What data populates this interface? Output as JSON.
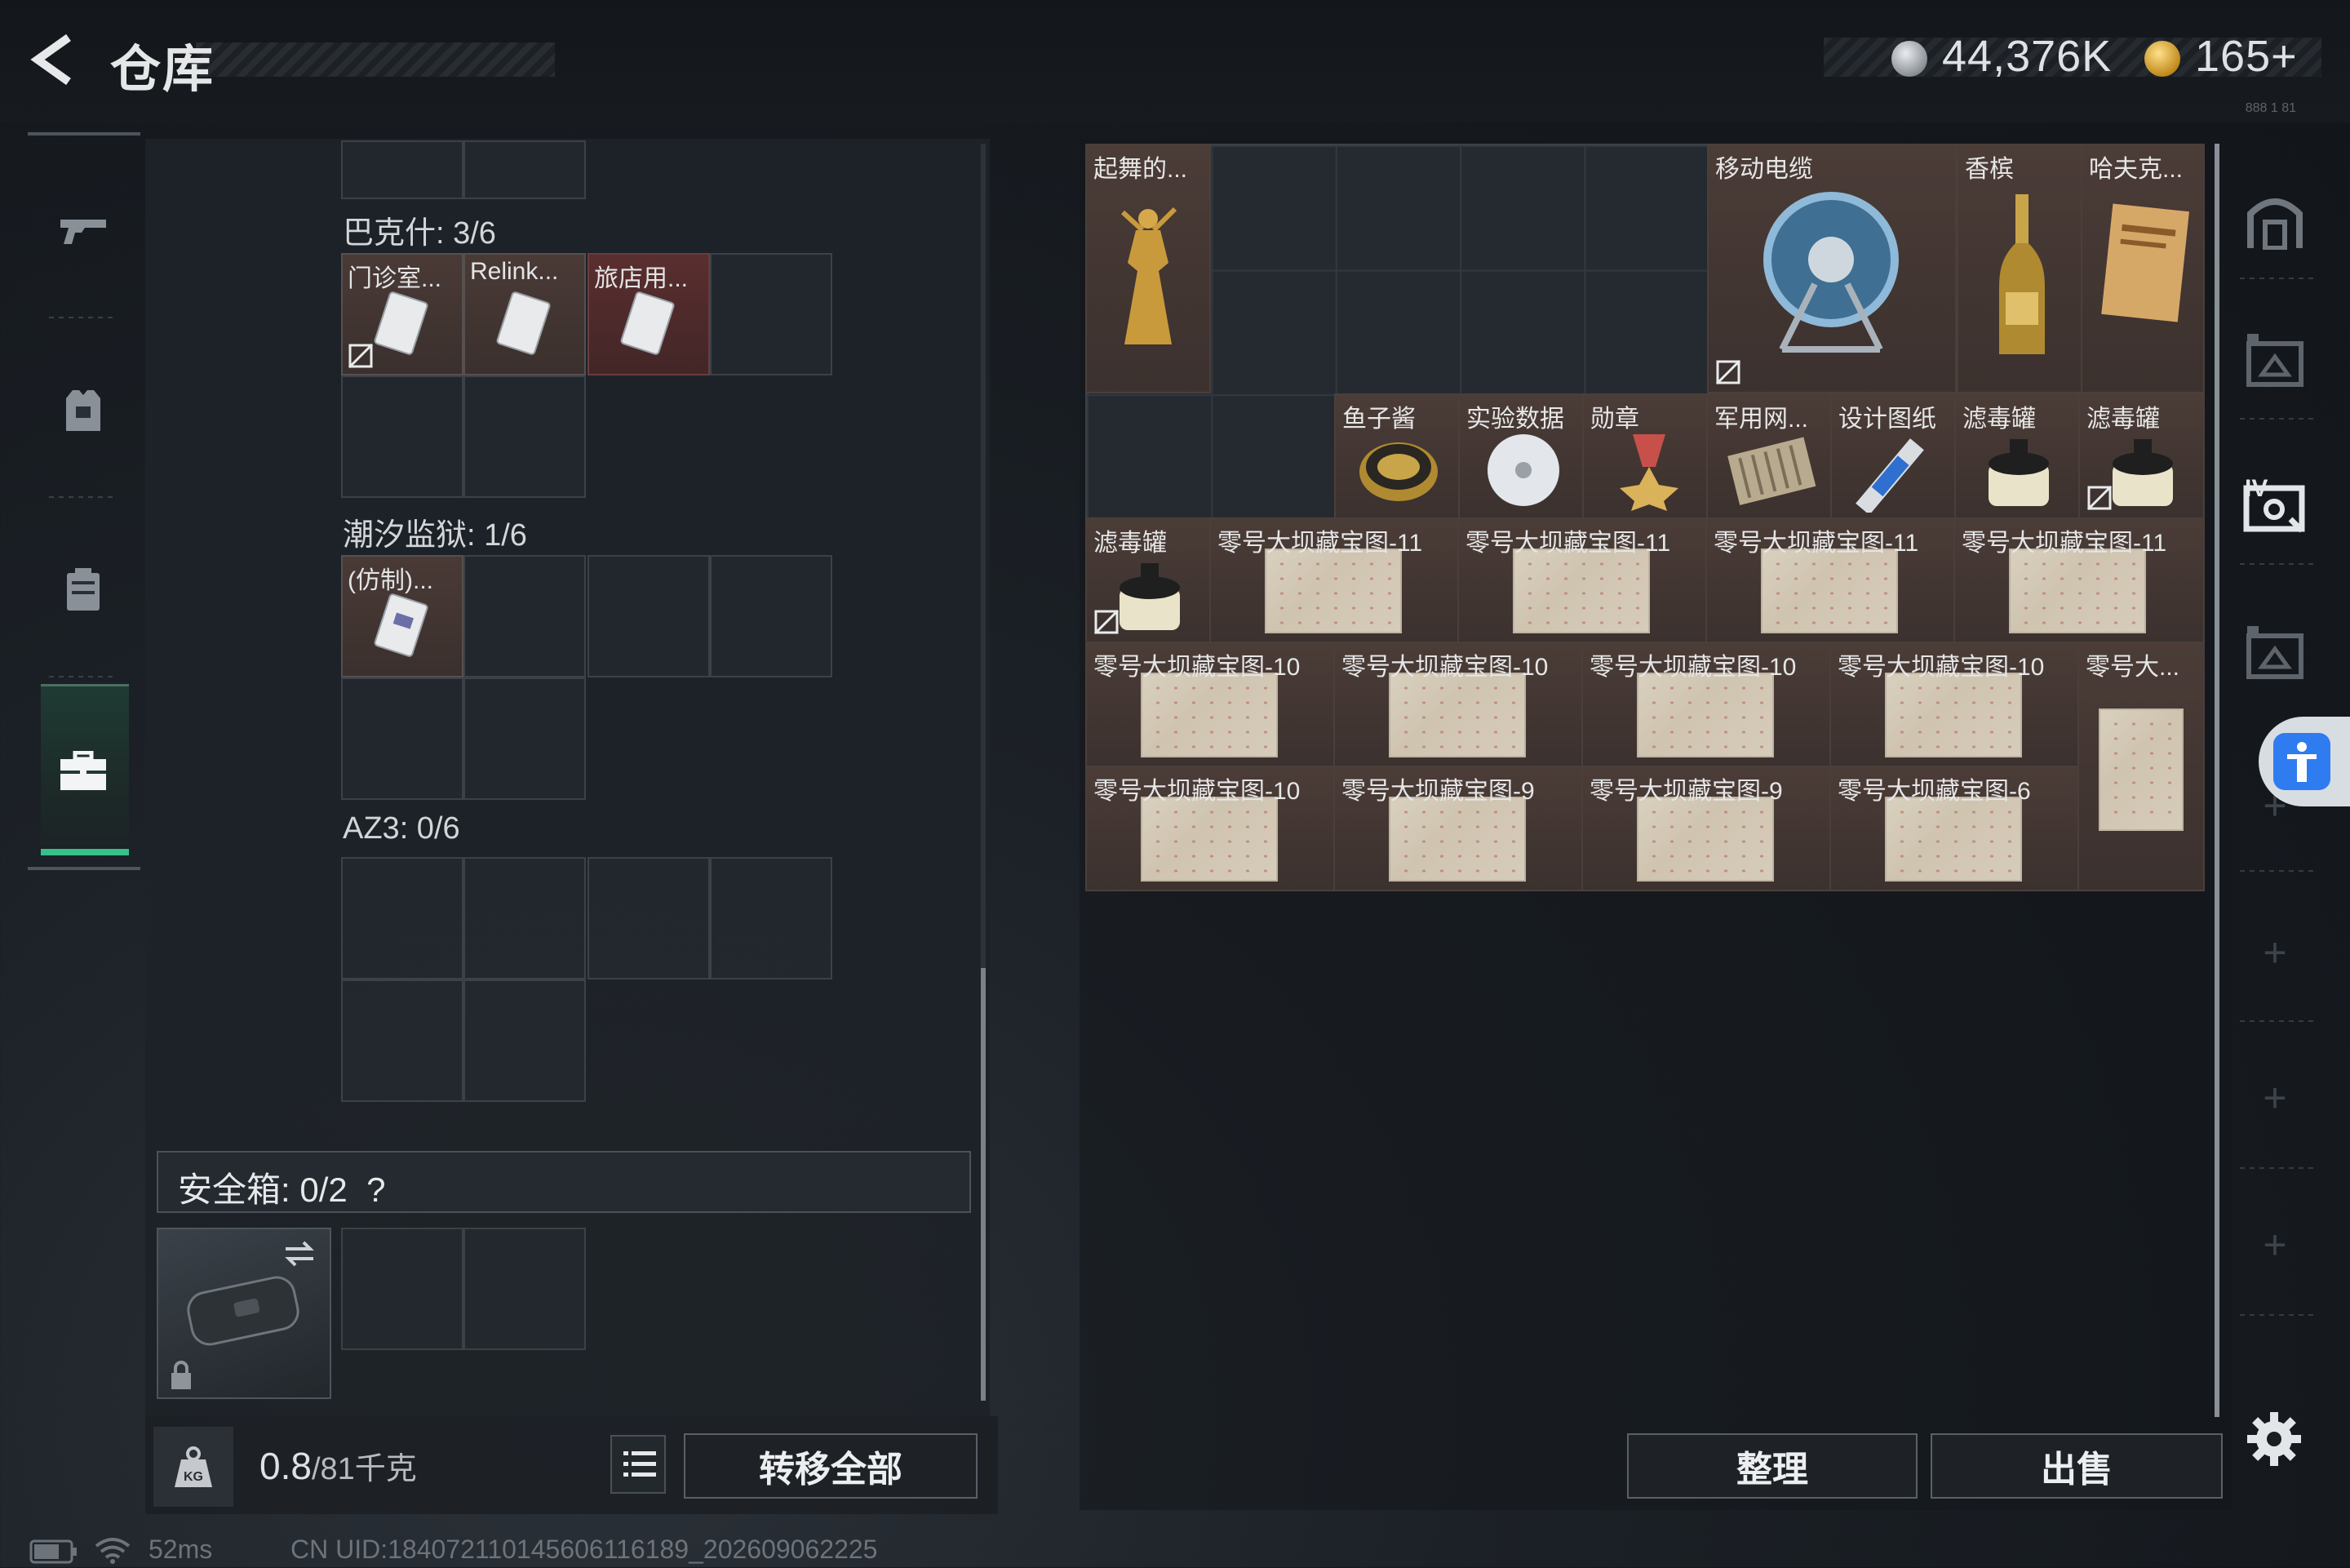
{
  "header": {
    "title": "仓库",
    "currency_primary": "44,376K",
    "currency_secondary": "165+",
    "tiny_code": "888 1 81"
  },
  "left_nav": {
    "items": [
      {
        "name": "weapons",
        "icon": "gun-icon"
      },
      {
        "name": "armor",
        "icon": "vest-icon"
      },
      {
        "name": "chest-rig",
        "icon": "rig-icon"
      },
      {
        "name": "backpack",
        "icon": "briefcase-icon",
        "active": true
      }
    ]
  },
  "containers": [
    {
      "label": "巴克什: 3/6",
      "items": [
        {
          "name": "门诊室...",
          "no_insure": true
        },
        {
          "name": "Relink..."
        },
        {
          "name": "旅店用...",
          "highlight": "red"
        }
      ]
    },
    {
      "label": "潮汐监狱: 1/6",
      "items": [
        {
          "name": "(仿制)..."
        }
      ]
    },
    {
      "label": "AZ3: 0/6",
      "items": []
    }
  ],
  "safe_box": {
    "label": "安全箱:",
    "count": "0/2",
    "help": "?"
  },
  "weight": {
    "value": "0.8",
    "max": "/81千克"
  },
  "buttons": {
    "transfer_all": "转移全部",
    "organize": "整理",
    "sell": "出售"
  },
  "stash_items": {
    "row1": [
      {
        "name": "起舞的..."
      },
      {
        "name": "移动电缆"
      },
      {
        "name": "香槟"
      },
      {
        "name": "哈夫克..."
      }
    ],
    "row2": [
      {
        "name": "鱼子酱"
      },
      {
        "name": "实验数据"
      },
      {
        "name": "勋章"
      },
      {
        "name": "军用网..."
      },
      {
        "name": "设计图纸"
      },
      {
        "name": "滤毒罐"
      },
      {
        "name": "滤毒罐"
      }
    ],
    "row3_filter": "滤毒罐",
    "row3_maps": [
      "零号大坝藏宝图-11",
      "零号大坝藏宝图-11",
      "零号大坝藏宝图-11",
      "零号大坝藏宝图-11"
    ],
    "row4_maps": [
      "零号大坝藏宝图-10",
      "零号大坝藏宝图-10",
      "零号大坝藏宝图-10",
      "零号大坝藏宝图-10"
    ],
    "row4_last": "零号大...",
    "row5_maps": [
      "零号大坝藏宝图-10",
      "零号大坝藏宝图-9",
      "零号大坝藏宝图-9",
      "零号大坝藏宝图-6"
    ]
  },
  "status_bar": {
    "ping": "52ms",
    "uid": "CN UID:1840721101456061161​89_202609062225"
  },
  "colors": {
    "accent_green": "#36c08a",
    "item_bg": "#4b3c37",
    "item_red_bg": "#5a2e2e",
    "accessibility_blue": "#2f7bf0"
  }
}
